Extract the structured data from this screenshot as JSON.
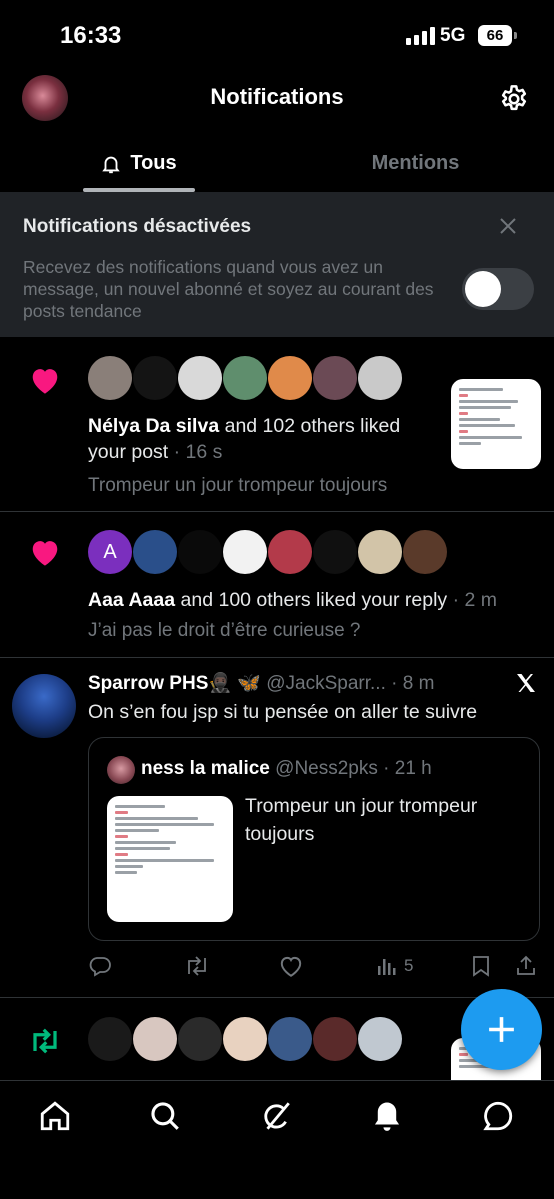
{
  "status_bar": {
    "time": "16:33",
    "network": "5G",
    "battery": "66"
  },
  "header": {
    "title": "Notifications"
  },
  "tabs": [
    {
      "label": "Tous",
      "active": true
    },
    {
      "label": "Mentions",
      "active": false
    }
  ],
  "banner": {
    "title": "Notifications désactivées",
    "text": "Recevez des notifications quand vous avez un message, un nouvel abonné et soyez au courant des posts tendance",
    "toggle_on": false
  },
  "notifications": [
    {
      "type": "like",
      "name": "Nélya Da silva",
      "action": "and 102 others liked your post",
      "time": "· 16 s",
      "preview": "Trompeur un jour trompeur toujours",
      "avatar_colors": [
        "#8a7f79",
        "#141414",
        "#d9d9d9",
        "#5f8e6d",
        "#e08a4a",
        "#6b4a55",
        "#c9c9c9"
      ]
    },
    {
      "type": "like",
      "name": "Aaa Aaaa",
      "action": "and 100 others liked your reply",
      "time": "· 2 m",
      "preview": "J’ai pas le droit d’être curieuse ?",
      "avatar_letter": "A",
      "avatar_colors": [
        "#7b2fbe",
        "#2a4f8a",
        "#0a0a0a",
        "#f2f2f2",
        "#b33a4a",
        "#101010",
        "#d2c4a8",
        "#5a3a2a"
      ]
    }
  ],
  "tweet": {
    "name": "Sparrow PHS🥷🏿 🦋",
    "handle": "@JackSparr...",
    "time": "· 8 m",
    "text": "On s’en fou jsp si tu pensée on aller te suivre",
    "quote": {
      "name": "ness la malice",
      "handle": "@Ness2pks",
      "time": "· 21 h",
      "text": "Trompeur un jour trompeur toujours"
    },
    "views": "5"
  },
  "retweet_avatar_colors": [
    "#1a1a1a",
    "#d8c7c0",
    "#2a2a2a",
    "#e8d2c0",
    "#3a5a8a",
    "#5a2a2a",
    "#c0c8d0"
  ],
  "colors": {
    "accent": "#1d9bf0",
    "like": "#f91880",
    "retweet": "#00ba7c",
    "muted": "#71767b"
  },
  "icons": [
    "home-icon",
    "search-icon",
    "grok-icon",
    "bell-icon",
    "messages-icon",
    "gear-icon",
    "bell-icon",
    "close-icon",
    "heart-icon",
    "x-logo-icon",
    "reply-icon",
    "retweet-icon",
    "like-icon",
    "views-icon",
    "bookmark-icon",
    "share-icon",
    "plus-icon"
  ]
}
